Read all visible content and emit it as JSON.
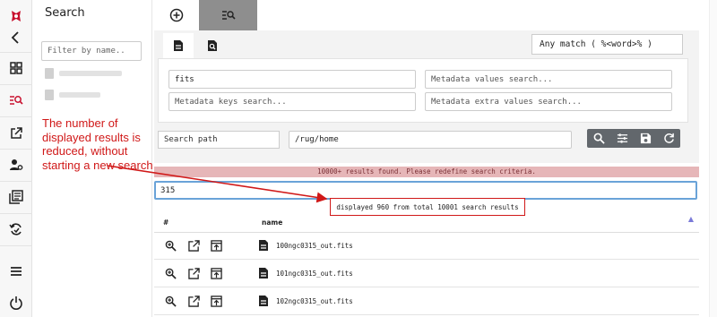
{
  "rail": {
    "items": [
      {
        "icon": "logo-icon"
      },
      {
        "icon": "back-icon"
      },
      {
        "icon": "dashboard-icon"
      },
      {
        "icon": "search-list-icon"
      },
      {
        "icon": "open-external-icon"
      },
      {
        "icon": "user-settings-icon"
      },
      {
        "icon": "library-icon"
      },
      {
        "icon": "sync-icon"
      },
      {
        "icon": "menu-icon"
      },
      {
        "icon": "power-icon"
      }
    ]
  },
  "panel": {
    "title": "Search",
    "filter_placeholder": "Filter by name.."
  },
  "search": {
    "match_mode": "Any match ( %<word>% )",
    "query_value": "fits",
    "metadata_values_placeholder": "Metadata values search...",
    "metadata_keys_placeholder": "Metadata keys search...",
    "metadata_extra_placeholder": "Metadata extra values search...",
    "path_label": "Search path",
    "path_value": "/rug/home"
  },
  "results": {
    "warning": "10000+ results found. Please redefine search criteria.",
    "filter_value": "315",
    "count_text": "displayed 960 from total 10001 search results",
    "col_num": "#",
    "col_name": "name",
    "sort_glyph": "▲",
    "rows": [
      {
        "name": "100ngc0315_out.fits"
      },
      {
        "name": "101ngc0315_out.fits"
      },
      {
        "name": "102ngc0315_out.fits"
      }
    ]
  },
  "annotation": {
    "text": "The number of displayed results is reduced, without starting a new search",
    "color": "#d01818"
  },
  "colors": {
    "active_tab": "#8e8e8e",
    "action_bar": "#62676c",
    "warning_bg": "#e6b6b8",
    "focus_border": "#6aa3d8"
  }
}
